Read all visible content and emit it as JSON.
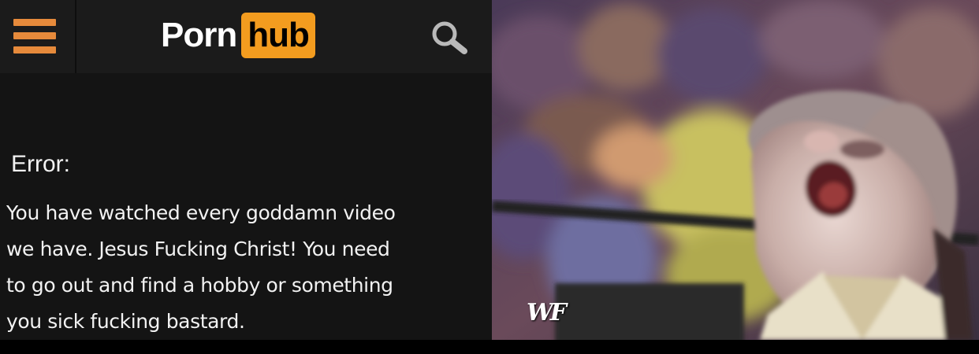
{
  "header": {
    "menu_icon": "hamburger-menu-icon",
    "logo_left": "Porn",
    "logo_right": "hub",
    "search_icon": "search-icon",
    "accent_color": "#f39c1f",
    "menu_color": "#e68a3b"
  },
  "error": {
    "title": "Error:",
    "lines": [
      "You have watched every goddamn video",
      "we have. Jesus Fucking Christ! You need",
      "to go out and find a hobby or something",
      "you sick fucking bastard."
    ]
  },
  "photo": {
    "watermark": "WF"
  }
}
